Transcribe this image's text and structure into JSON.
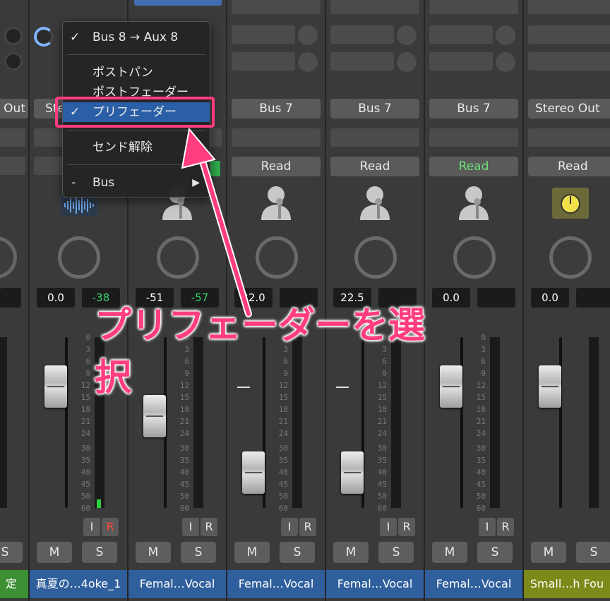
{
  "colors": {
    "accent_pink": "#ff3d7f",
    "menu_highlight": "#2a5ea6",
    "green_read": "#6fe07a",
    "green_value": "#37d26b",
    "name_blue": "#2f5f9c",
    "name_green": "#3d8f34",
    "name_olive": "#7b8a18"
  },
  "strips": [
    {
      "output": "Out",
      "automation": "",
      "pan_value": "",
      "send_value": "",
      "name": "定",
      "scale": false
    },
    {
      "output": "Ste",
      "automation": "",
      "pan_value": "0.0",
      "send_value": "-38",
      "name": "真夏の…4oke_1",
      "scale": true,
      "ir": [
        "I",
        "R"
      ]
    },
    {
      "output": "",
      "automation": "",
      "pan_value": "-51",
      "send_value": "-57",
      "name": "Femal…Vocal",
      "scale": true,
      "ir": [
        "I",
        "R"
      ]
    },
    {
      "output": "Bus 7",
      "automation": "Read",
      "pan_value": "22.0",
      "send_value": "",
      "name": "Femal…Vocal",
      "scale": true,
      "ir": [
        "I",
        "R"
      ]
    },
    {
      "output": "Bus 7",
      "automation": "Read",
      "pan_value": "22.5",
      "send_value": "",
      "name": "Femal…Vocal",
      "scale": true,
      "ir": [
        "I",
        "R"
      ]
    },
    {
      "output": "Bus 7",
      "automation": "Read",
      "pan_value": "0.0",
      "send_value": "",
      "name": "Femal…Vocal",
      "scale": true,
      "ir": [
        "I",
        "R"
      ]
    },
    {
      "output": "Stereo Out",
      "automation": "Read",
      "pan_value": "0.0",
      "send_value": "",
      "name": "Small…h Fou",
      "scale": false
    }
  ],
  "scale_labels": [
    "0",
    "3",
    "6",
    "9",
    "12",
    "15",
    "18",
    "21",
    "24",
    "30",
    "35",
    "40",
    "45",
    "50",
    "60"
  ],
  "buttons": {
    "mute": "M",
    "solo": "S"
  },
  "menu": {
    "item_bus8": {
      "check": "✓",
      "label": "Bus 8 → Aux 8"
    },
    "item_postpan": "ポストパン",
    "item_postfader": "ポストフェーダー",
    "item_prefader": {
      "check": "✓",
      "label": "プリフェーダー"
    },
    "item_release": "センド解除",
    "item_bus": {
      "dash": "-",
      "label": "Bus",
      "arrow": "▶"
    }
  },
  "annotation": {
    "line1": "プリフェーダーを選",
    "line2": "択"
  }
}
